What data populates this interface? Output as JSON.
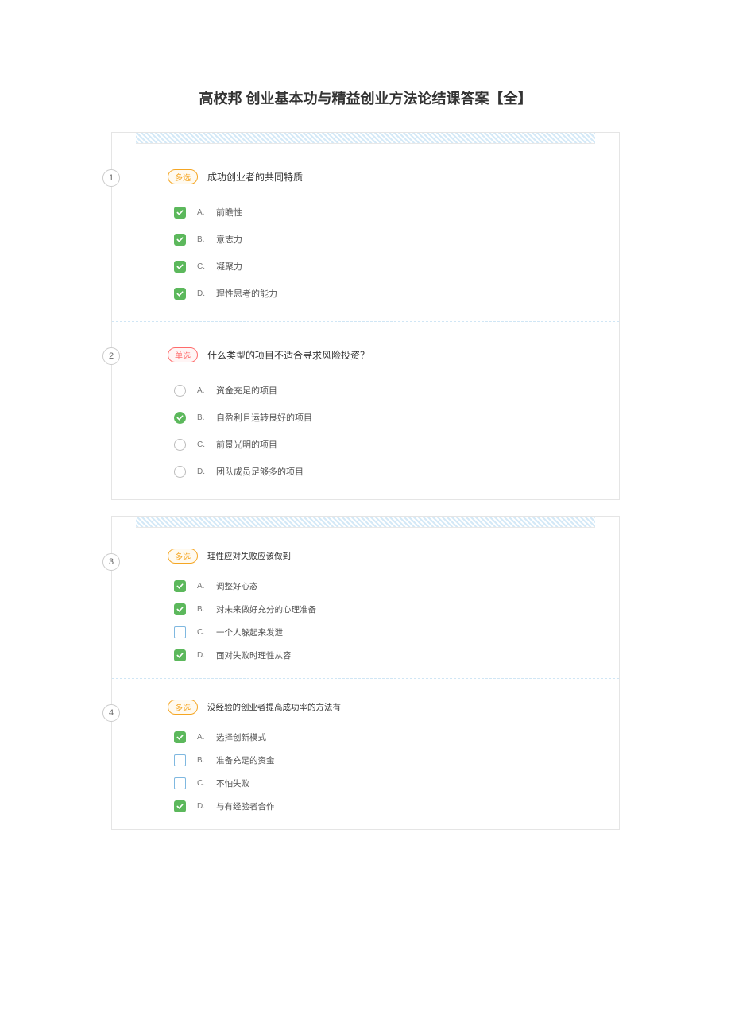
{
  "title": "高校邦 创业基本功与精益创业方法论结课答案【全】",
  "sections": [
    {
      "questions": [
        {
          "num": "1",
          "type": "multi",
          "typeLabel": "多选",
          "text": "成功创业者的共同特质",
          "options": [
            {
              "letter": "A.",
              "text": "前瞻性",
              "marker": "check-sq"
            },
            {
              "letter": "B.",
              "text": "意志力",
              "marker": "check-sq"
            },
            {
              "letter": "C.",
              "text": "凝聚力",
              "marker": "check-sq"
            },
            {
              "letter": "D.",
              "text": "理性思考的能力",
              "marker": "check-sq"
            }
          ]
        },
        {
          "num": "2",
          "type": "single",
          "typeLabel": "单选",
          "text": "什么类型的项目不适合寻求风险投资？",
          "options": [
            {
              "letter": "A.",
              "text": "资金充足的项目",
              "marker": "radio"
            },
            {
              "letter": "B.",
              "text": "自盈利且运转良好的项目",
              "marker": "check-rd"
            },
            {
              "letter": "C.",
              "text": "前景光明的项目",
              "marker": "radio"
            },
            {
              "letter": "D.",
              "text": "团队成员足够多的项目",
              "marker": "radio"
            }
          ]
        }
      ]
    },
    {
      "questions": [
        {
          "num": "3",
          "type": "multi",
          "typeLabel": "多选",
          "text": "理性应对失败应该做到",
          "options": [
            {
              "letter": "A.",
              "text": "调整好心态",
              "marker": "check-sq"
            },
            {
              "letter": "B.",
              "text": "对未来做好充分的心理准备",
              "marker": "check-sq"
            },
            {
              "letter": "C.",
              "text": "一个人躲起来发泄",
              "marker": "box"
            },
            {
              "letter": "D.",
              "text": "面对失败时理性从容",
              "marker": "check-sq"
            }
          ]
        },
        {
          "num": "4",
          "type": "multi",
          "typeLabel": "多选",
          "text": "没经验的创业者提高成功率的方法有",
          "options": [
            {
              "letter": "A.",
              "text": "选择创新模式",
              "marker": "check-sq"
            },
            {
              "letter": "B.",
              "text": "准备充足的资金",
              "marker": "box"
            },
            {
              "letter": "C.",
              "text": "不怕失败",
              "marker": "box"
            },
            {
              "letter": "D.",
              "text": "与有经验者合作",
              "marker": "check-sq"
            }
          ]
        }
      ]
    }
  ]
}
